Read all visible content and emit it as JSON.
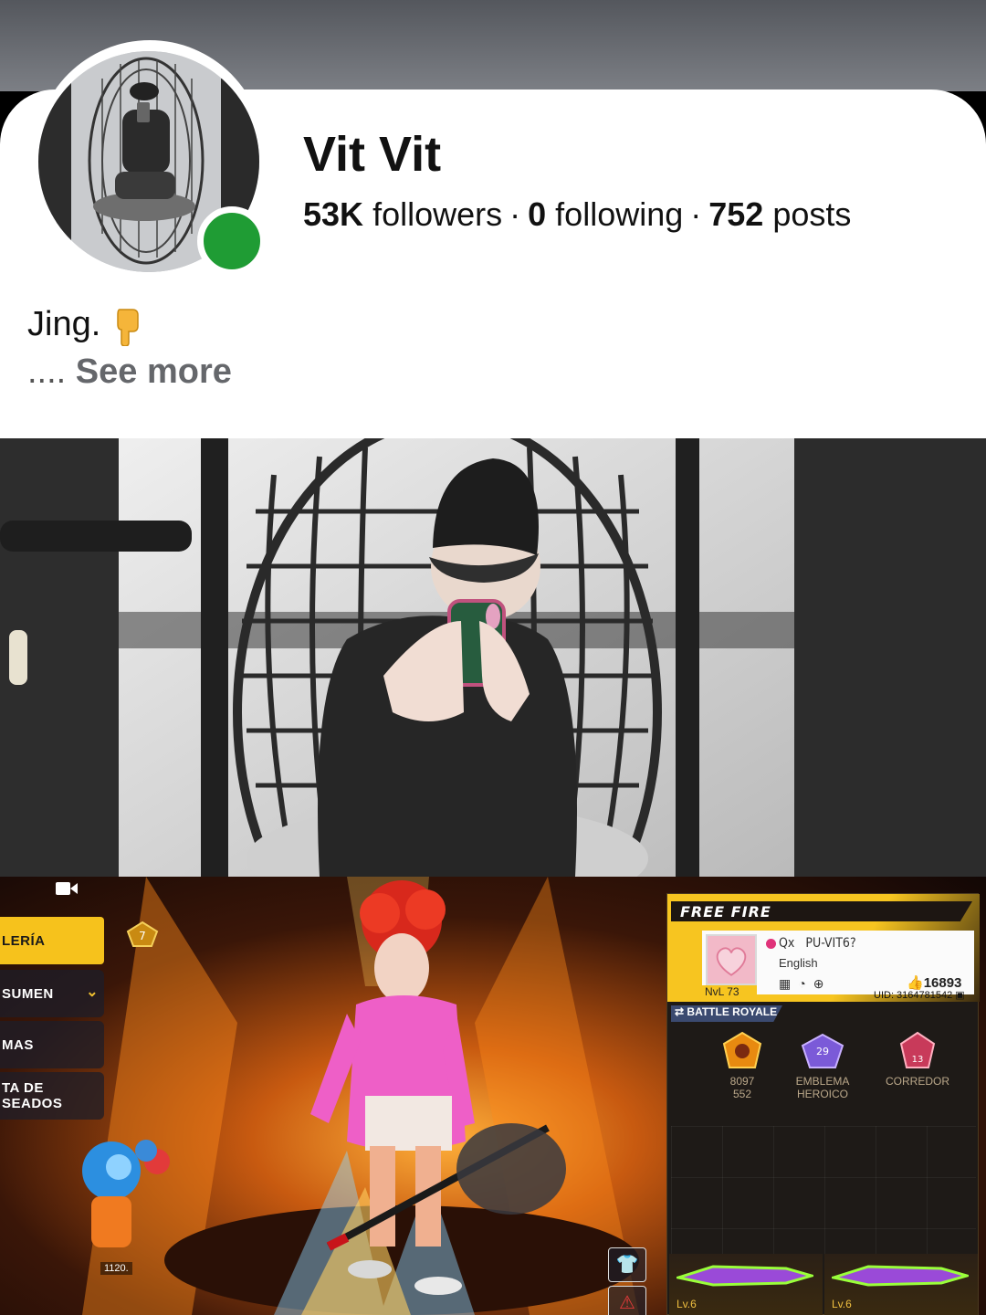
{
  "profile": {
    "name": "Vit Vit",
    "followers_count": "53K",
    "followers_label": "followers",
    "following_count": "0",
    "following_label": "following",
    "posts_count": "752",
    "posts_label": "posts",
    "separator": "·",
    "bio": "Jing.",
    "bio_emoji": "pointing-down-hand-icon",
    "see_more_prefix": "....",
    "see_more_label": "See more",
    "online_color": "#1f9c34"
  },
  "game": {
    "menu_items": [
      {
        "label": "LERÍA"
      },
      {
        "label": "SUMEN"
      },
      {
        "label": "MAS"
      },
      {
        "label": "TA DE\nSEADOS"
      }
    ],
    "rank_badge": "7",
    "pet_count": "1120.",
    "panel": {
      "logo": "FREE FIRE",
      "guild": "Qx",
      "nickname": "PU-VIT6?",
      "language": "English",
      "likes": "16893",
      "level": "NvL 73",
      "uid": "UID: 3164781542",
      "mode": "BATTLE ROYALE",
      "badges": [
        {
          "line1": "8097",
          "line2": "552"
        },
        {
          "line1": "EMBLEMA",
          "line2": "HEROICO"
        },
        {
          "line1": "CORREDOR",
          "line2": ""
        }
      ],
      "badge_number_left": "29",
      "badge_number_right": "13",
      "weapons": [
        {
          "level": "Lv.6"
        },
        {
          "level": "Lv.6"
        }
      ]
    },
    "accent_color": "#f6c21c"
  }
}
